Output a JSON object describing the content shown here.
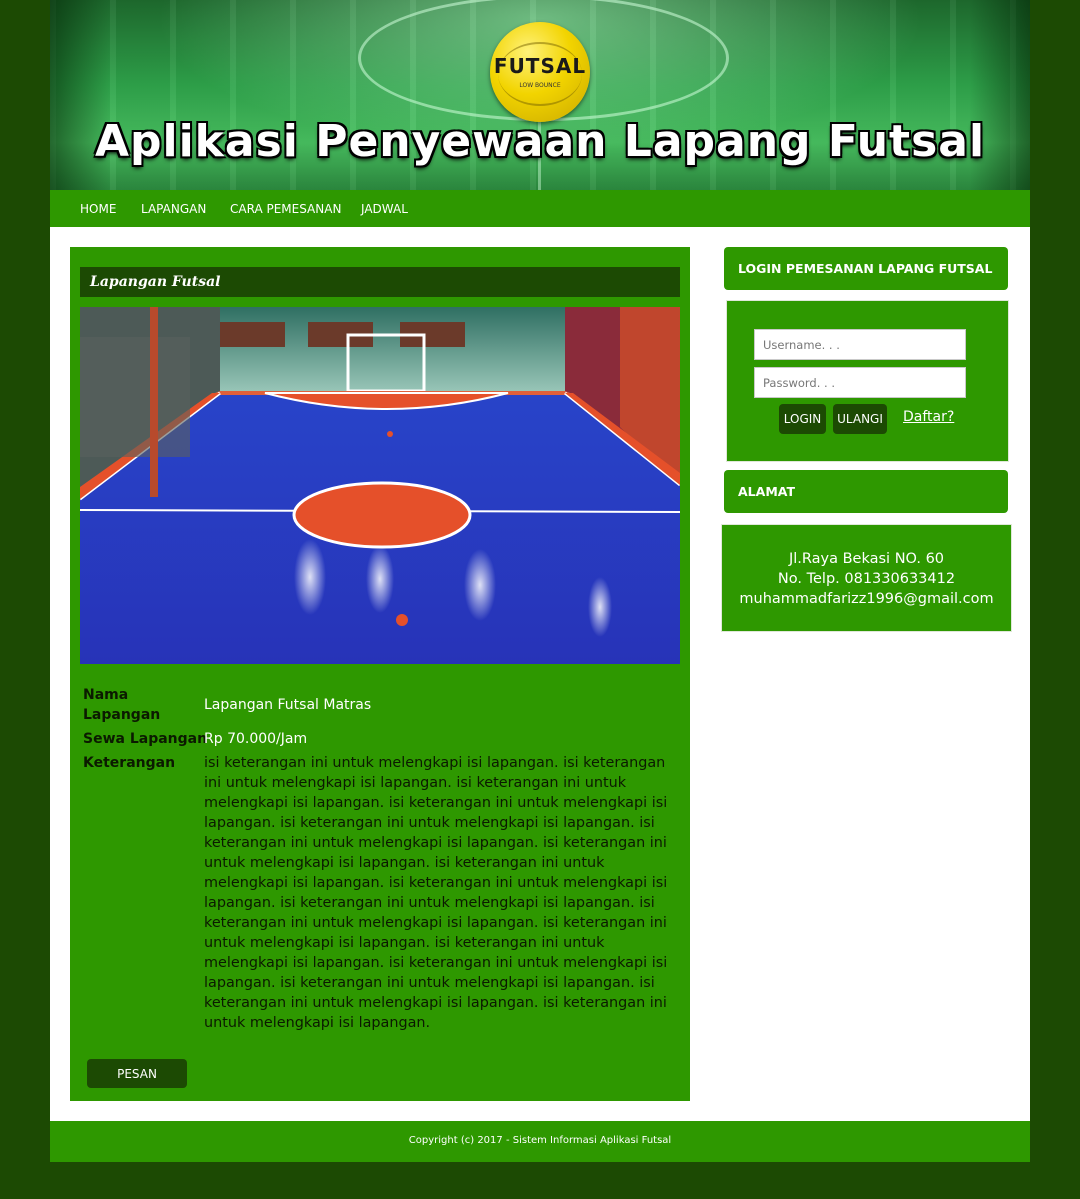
{
  "header": {
    "title": "Aplikasi Penyewaan Lapang Futsal",
    "ball_text": "FUTSAL",
    "ball_subtext": "LOW BOUNCE"
  },
  "nav": {
    "items": [
      {
        "label": "HOME"
      },
      {
        "label": "LAPANGAN"
      },
      {
        "label": "CARA PEMESANAN"
      },
      {
        "label": "JADWAL"
      }
    ]
  },
  "main": {
    "section_title": "Lapangan Futsal",
    "court_image": "futsal-court-photo",
    "fields": {
      "nama_label": "Nama Lapangan",
      "nama_value": "Lapangan Futsal Matras",
      "sewa_label": "Sewa Lapangan",
      "sewa_value": "Rp 70.000/Jam",
      "keterangan_label": "Keterangan",
      "keterangan_value": "isi keterangan ini untuk melengkapi isi lapangan. isi keterangan ini untuk melengkapi isi lapangan. isi keterangan ini untuk melengkapi isi lapangan. isi keterangan ini untuk melengkapi isi lapangan. isi keterangan ini untuk melengkapi isi lapangan. isi keterangan ini untuk melengkapi isi lapangan. isi keterangan ini untuk melengkapi isi lapangan. isi keterangan ini untuk melengkapi isi lapangan. isi keterangan ini untuk melengkapi isi lapangan. isi keterangan ini untuk melengkapi isi lapangan. isi keterangan ini untuk melengkapi isi lapangan. isi keterangan ini untuk melengkapi isi lapangan. isi keterangan ini untuk melengkapi isi lapangan. isi keterangan ini untuk melengkapi isi lapangan. isi keterangan ini untuk melengkapi isi lapangan. isi keterangan ini untuk melengkapi isi lapangan. isi keterangan ini untuk melengkapi isi lapangan."
    },
    "pesan_label": "PESAN"
  },
  "sidebar": {
    "login_title": "LOGIN PEMESANAN LAPANG FUTSAL",
    "username_placeholder": "Username. . .",
    "password_placeholder": "Password. . .",
    "login_label": "LOGIN",
    "ulangi_label": "ULANGI",
    "daftar_label": "Daftar?",
    "alamat_title": "ALAMAT",
    "address": "Jl.Raya Bekasi NO. 60",
    "phone": "No. Telp. 081330633412",
    "email": "muhammadfarizz1996@gmail.com"
  },
  "footer": {
    "copyright": "Copyright (c) 2017 - Sistem Informasi Aplikasi Futsal"
  },
  "colors": {
    "page_bg": "#1c4a03",
    "accent_green": "#2e9800",
    "dark_green": "#1c4a03",
    "court_blue": "#2a3ccf",
    "court_orange": "#e5502a"
  }
}
